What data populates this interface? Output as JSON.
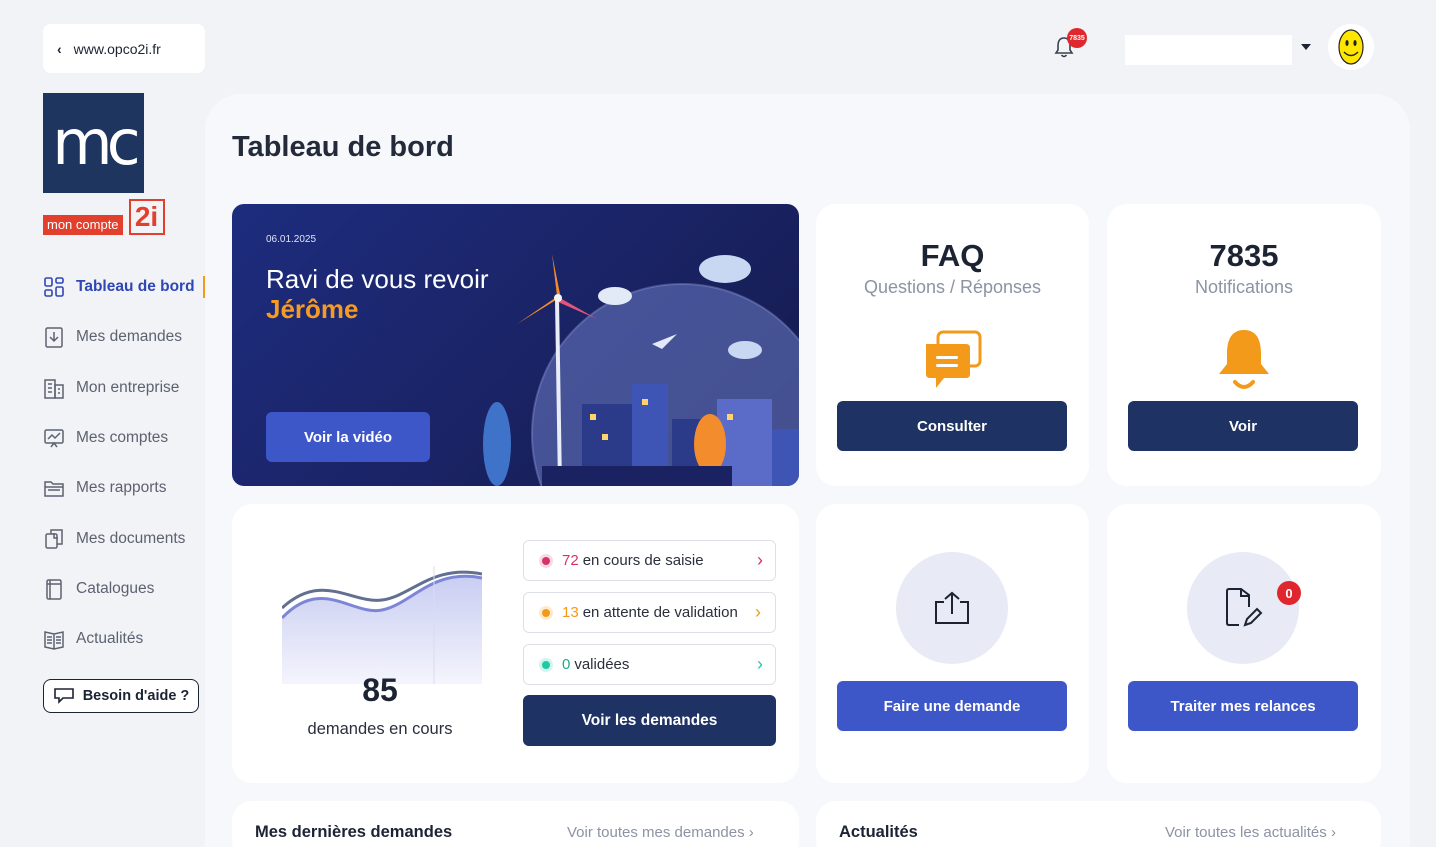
{
  "topbar": {
    "back_label": "www.opco2i.fr",
    "bell_badge": "7835"
  },
  "logo": {
    "mc": "mc",
    "text": "mon compte",
    "suffix": "2i"
  },
  "sidebar": {
    "items": [
      {
        "label": "Tableau de bord",
        "icon": "dashboard-icon",
        "active": true
      },
      {
        "label": "Mes demandes",
        "icon": "download-doc-icon"
      },
      {
        "label": "Mon entreprise",
        "icon": "building-icon"
      },
      {
        "label": "Mes comptes",
        "icon": "chart-icon"
      },
      {
        "label": "Mes rapports",
        "icon": "folder-icon"
      },
      {
        "label": "Mes documents",
        "icon": "documents-icon"
      },
      {
        "label": "Catalogues",
        "icon": "catalog-icon"
      },
      {
        "label": "Actualités",
        "icon": "news-icon"
      }
    ],
    "help_label": "Besoin d'aide ?"
  },
  "main": {
    "title": "Tableau de bord"
  },
  "hero": {
    "date": "06.01.2025",
    "greeting": "Ravi de vous revoir",
    "name": "Jérôme",
    "button": "Voir la vidéo"
  },
  "faq": {
    "title": "FAQ",
    "subtitle": "Questions / Réponses",
    "button": "Consulter"
  },
  "notifications": {
    "count": "7835",
    "label": "Notifications",
    "button": "Voir"
  },
  "demandes": {
    "count": "85",
    "label": "demandes en cours",
    "statuses": [
      {
        "num": "72",
        "text": "en cours de saisie",
        "color": "#d6336c"
      },
      {
        "num": "13",
        "text": "en attente de validation",
        "color": "#f39a1b"
      },
      {
        "num": "0",
        "text": "validées",
        "color": "#20c9a6"
      }
    ],
    "button": "Voir les demandes"
  },
  "faire_demande": {
    "button": "Faire une demande"
  },
  "relances": {
    "badge": "0",
    "button": "Traiter mes relances"
  },
  "bottom": {
    "left_title": "Mes dernières demandes",
    "left_link": "Voir toutes mes demandes",
    "right_title": "Actualités",
    "right_link": "Voir toutes les actualités"
  },
  "colors": {
    "navy": "#1e3263",
    "blue": "#3e57c8",
    "orange": "#f39a1b",
    "red": "#e0272d"
  }
}
